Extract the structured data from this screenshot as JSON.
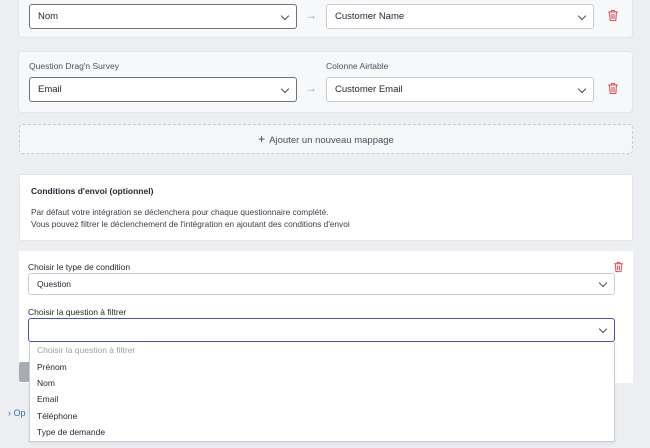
{
  "mappings": [
    {
      "question_label": "",
      "airtable_label": "",
      "question_value": "Nom",
      "airtable_value": "Customer Name"
    },
    {
      "question_label": "Question Drag'n Survey",
      "airtable_label": "Colonne Airtable",
      "question_value": "Email",
      "airtable_value": "Customer Email"
    }
  ],
  "add_mapping": {
    "plus": "+",
    "label": "Ajouter un nouveau mappage"
  },
  "conditions": {
    "title": "Conditions d'envoi (optionnel)",
    "desc_line1": "Par défaut votre intégration se déclenchera pour chaque questionnaire complété.",
    "desc_line2": "Vous pouvez filtrer le déclenchement de l'intégration en ajoutant des conditions d'envoi"
  },
  "condition_form": {
    "type_label": "Choisir le type de condition",
    "type_value": "Question",
    "question_label": "Choisir la question à filtrer",
    "question_value": ""
  },
  "dropdown": {
    "placeholder": "Choisir la question à filtrer",
    "options": [
      "Prénom",
      "Nom",
      "Email",
      "Téléphone",
      "Type de demande"
    ]
  },
  "bottom_link": "Op",
  "colors": {
    "accent": "#4b4fc0",
    "danger": "#e05252",
    "link": "#2f6fbf"
  }
}
